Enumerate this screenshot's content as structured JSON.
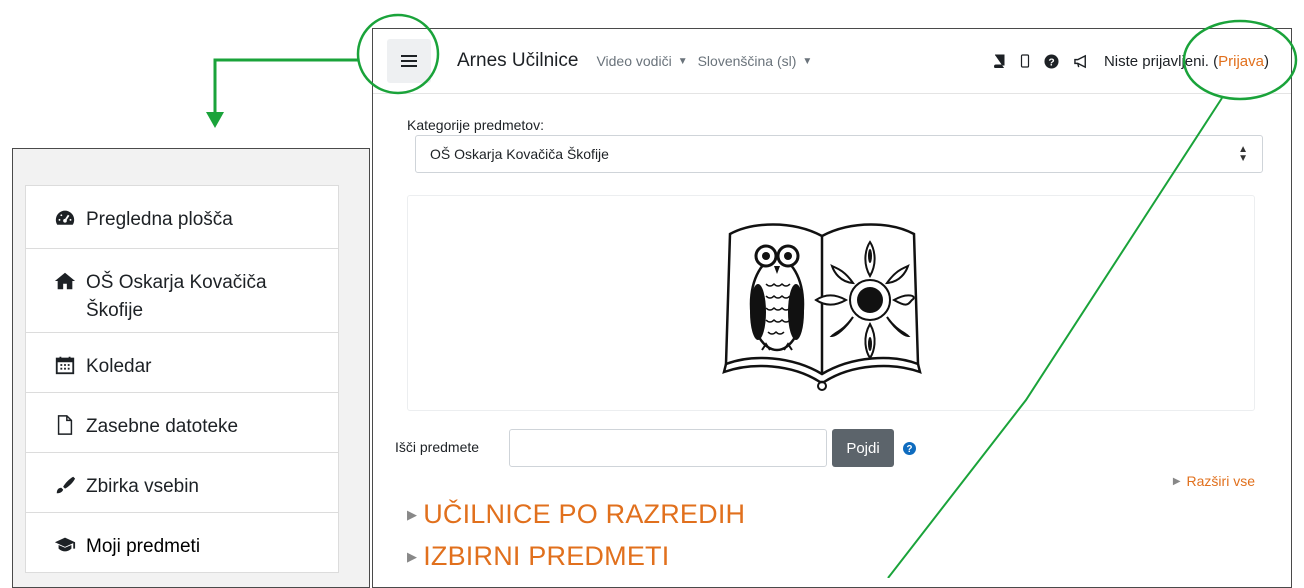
{
  "sidebar": {
    "items": [
      {
        "label": "Pregledna plošča",
        "icon": "dashboard-icon"
      },
      {
        "label": "OŠ Oskarja Kovačiča Škofije",
        "icon": "home-icon"
      },
      {
        "label": "Koledar",
        "icon": "calendar-icon"
      },
      {
        "label": "Zasebne datoteke",
        "icon": "file-icon"
      },
      {
        "label": "Zbirka vsebin",
        "icon": "brush-icon"
      },
      {
        "label": "Moji predmeti",
        "icon": "graduation-cap-icon"
      }
    ]
  },
  "topbar": {
    "site_name": "Arnes Učilnice",
    "video_menu": "Video vodiči",
    "language_menu": "Slovenščina (sl)",
    "login_prefix": "Niste prijavljeni. (",
    "login_link": "Prijava",
    "login_suffix": ")"
  },
  "main": {
    "category_label": "Kategorije predmetov:",
    "category_selected": "OŠ Oskarja Kovačiča Škofije",
    "search_label": "Išči predmete",
    "search_value": "",
    "go_button": "Pojdi",
    "expand_all": "Razširi vse",
    "categories": [
      "UČILNICE PO RAZREDIH",
      "IZBIRNI PREDMETI"
    ]
  },
  "colors": {
    "accent": "#e1701d",
    "annotation_green": "#1aa33a",
    "button_grey": "#5c646b"
  }
}
